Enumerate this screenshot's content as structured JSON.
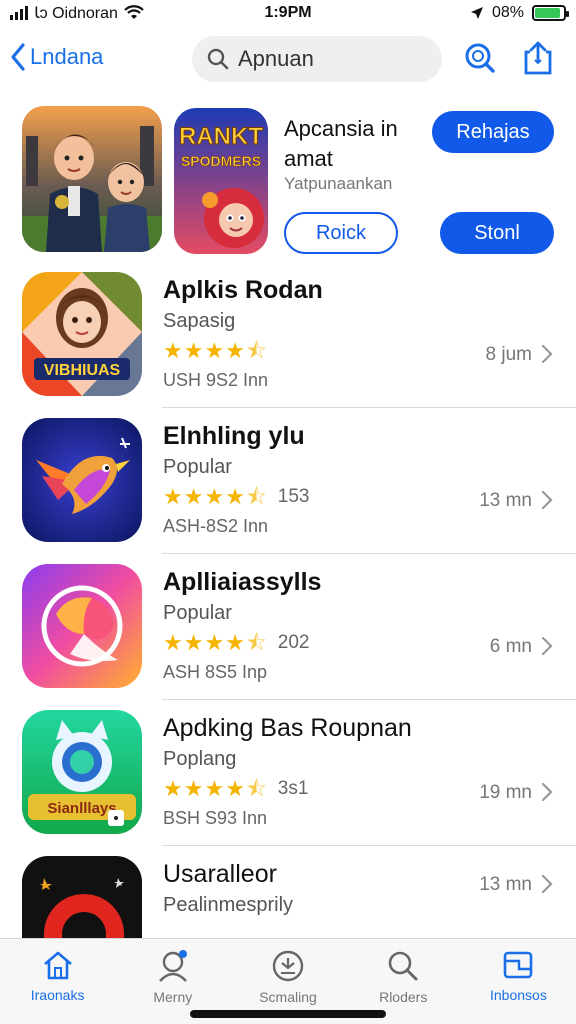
{
  "status_bar": {
    "carrier": "Ꙇᴐ Oidnoran",
    "time": "1:9PM",
    "battery": "08%",
    "battery_level": 0.9
  },
  "nav": {
    "back_label": "Lndana",
    "search_text": "Apnuan"
  },
  "featured": {
    "game_art_text": "RANKT\nSPODMERS",
    "title": "Apcansia in amat",
    "subtitle": "Yatpunaankan",
    "btn_top": "Rehajas",
    "btn_outline": "Roick",
    "btn_bottom": "Stonl"
  },
  "apps": [
    {
      "name": "Aplkis Rodan",
      "category": "Sapasig",
      "rating": 4.5,
      "rating_count": "",
      "size": "USH 9S2 Inn",
      "time": "8 jum",
      "icon_text": "VIBHIUAS"
    },
    {
      "name": "Elnhling ylu",
      "category": "Popular",
      "rating": 4.5,
      "rating_count": "153",
      "size": "ASH-8S2 Inn",
      "time": "13 mn",
      "icon_text": ""
    },
    {
      "name": "Aplliaiassylls",
      "category": "Popular",
      "rating": 4.5,
      "rating_count": "202",
      "size": "ASH 8S5 Inp",
      "time": "6 mn",
      "icon_text": ""
    },
    {
      "name": "Apdking Bas Roupnan",
      "category": "Poplang",
      "rating": 4.5,
      "rating_count": "3s1",
      "size": "BSH S93 Inn",
      "time": "19 mn",
      "icon_text": "Sianlllays"
    },
    {
      "name": "Usaralleor",
      "category": "Pealinmesprily",
      "rating": 0,
      "rating_count": "",
      "size": "",
      "time": "13 mn",
      "icon_text": ""
    }
  ],
  "tabs": [
    {
      "label": "Iraonaks",
      "icon": "home-icon",
      "active": true
    },
    {
      "label": "Merny",
      "icon": "person-icon",
      "active": false
    },
    {
      "label": "Scmaling",
      "icon": "updates-icon",
      "active": false
    },
    {
      "label": "Rloders",
      "icon": "search-icon",
      "active": false
    },
    {
      "label": "Inbonsos",
      "icon": "library-icon",
      "active": true
    }
  ],
  "colors": {
    "accent": "#1159e8",
    "star": "#f4b400",
    "battery": "#34c759"
  }
}
